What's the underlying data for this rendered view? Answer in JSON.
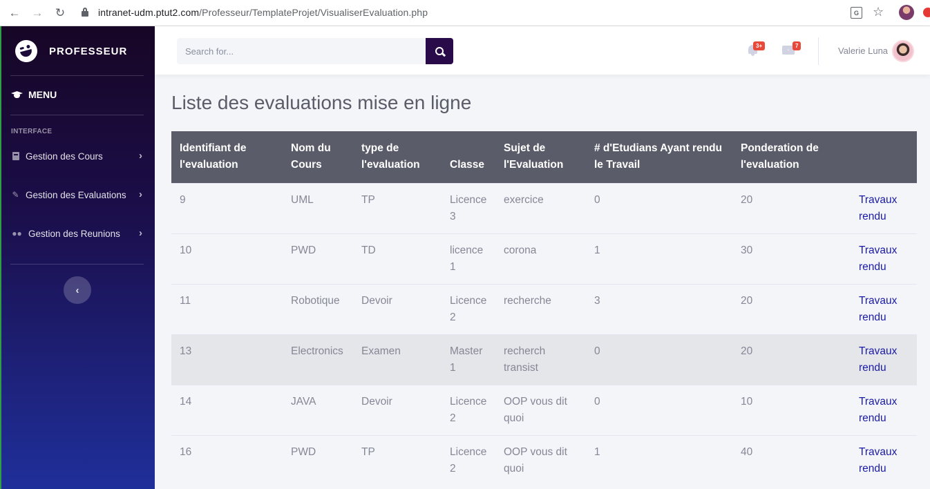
{
  "browser": {
    "url_host": "intranet-udm.ptut2.com",
    "url_path": "/Professeur/TemplateProjet/VisualiserEvaluation.php"
  },
  "sidebar": {
    "brand": "PROFESSEUR",
    "menu_label": "MENU",
    "section_label": "INTERFACE",
    "items": [
      {
        "label": "Gestion des Cours",
        "icon": "book-icon"
      },
      {
        "label": "Gestion des Evaluations",
        "icon": "edit-icon"
      },
      {
        "label": "Gestion des Reunions",
        "icon": "users-icon"
      }
    ]
  },
  "topbar": {
    "search_placeholder": "Search for...",
    "alerts_badge": "3+",
    "messages_badge": "7",
    "username": "Valerie Luna"
  },
  "main": {
    "title": "Liste des evaluations mise en ligne",
    "columns": [
      "Identifiant de l'evaluation",
      "Nom du Cours",
      "type de l'evaluation",
      "Classe",
      "Sujet de l'Evaluation",
      "# d'Etudians Ayant rendu le Travail",
      "Ponderation de l'evaluation",
      ""
    ],
    "rows": [
      {
        "id": "9",
        "cours": "UML",
        "type": "TP",
        "classe": "Licence 3",
        "sujet": "exercice",
        "nb": "0",
        "ponderation": "20",
        "link": "Travaux rendu"
      },
      {
        "id": "10",
        "cours": "PWD",
        "type": "TD",
        "classe": "licence 1",
        "sujet": "corona",
        "nb": "1",
        "ponderation": "30",
        "link": "Travaux rendu"
      },
      {
        "id": "11",
        "cours": "Robotique",
        "type": "Devoir",
        "classe": "Licence 2",
        "sujet": "recherche",
        "nb": "3",
        "ponderation": "20",
        "link": "Travaux rendu"
      },
      {
        "id": "13",
        "cours": "Electronics",
        "type": "Examen",
        "classe": "Master 1",
        "sujet": "recherch transist",
        "nb": "0",
        "ponderation": "20",
        "link": "Travaux rendu"
      },
      {
        "id": "14",
        "cours": "JAVA",
        "type": "Devoir",
        "classe": "Licence 2",
        "sujet": "OOP vous dit quoi",
        "nb": "0",
        "ponderation": "10",
        "link": "Travaux rendu"
      },
      {
        "id": "16",
        "cours": "PWD",
        "type": "TP",
        "classe": "Licence 2",
        "sujet": "OOP vous dit quoi",
        "nb": "1",
        "ponderation": "40",
        "link": "Travaux rendu"
      }
    ]
  }
}
